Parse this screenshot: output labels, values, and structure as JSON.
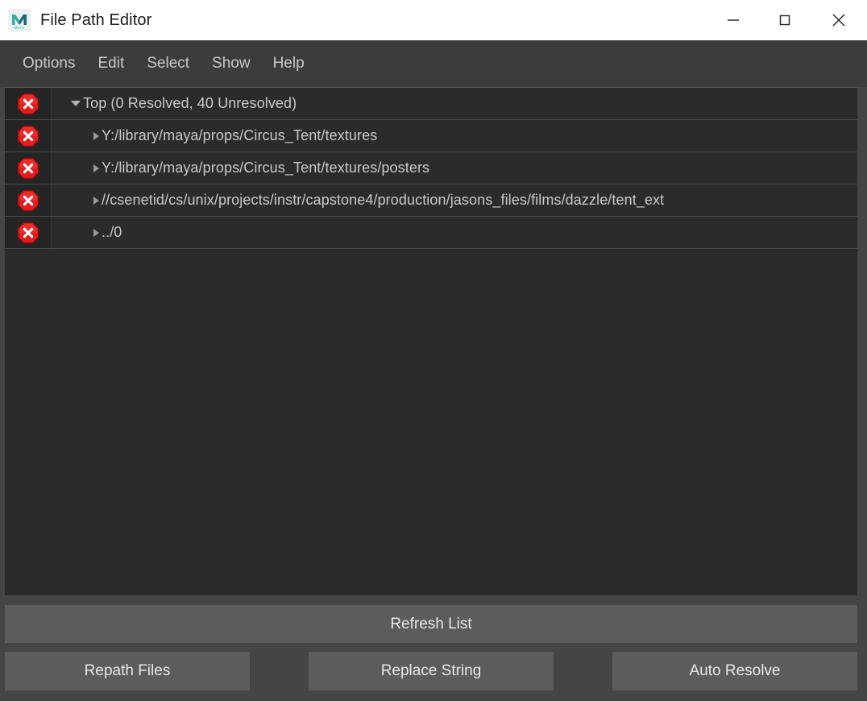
{
  "window": {
    "title": "File Path Editor",
    "app_icon": "maya-logo-icon",
    "controls": {
      "minimize": "minimize-icon",
      "maximize": "maximize-icon",
      "close": "close-icon"
    }
  },
  "menubar": {
    "items": [
      {
        "label": "Options"
      },
      {
        "label": "Edit"
      },
      {
        "label": "Select"
      },
      {
        "label": "Show"
      },
      {
        "label": "Help"
      }
    ]
  },
  "list": {
    "rows": [
      {
        "label": "Top (0 Resolved, 40 Unresolved)",
        "status": "unresolved",
        "status_icon": "error-x-icon",
        "expanded": true,
        "depth": 0
      },
      {
        "label": "Y:/library/maya/props/Circus_Tent/textures",
        "status": "unresolved",
        "status_icon": "error-x-icon",
        "expanded": false,
        "depth": 1
      },
      {
        "label": "Y:/library/maya/props/Circus_Tent/textures/posters",
        "status": "unresolved",
        "status_icon": "error-x-icon",
        "expanded": false,
        "depth": 1
      },
      {
        "label": "//csenetid/cs/unix/projects/instr/capstone4/production/jasons_files/films/dazzle/tent_ext",
        "status": "unresolved",
        "status_icon": "error-x-icon",
        "expanded": false,
        "depth": 1
      },
      {
        "label": "../0",
        "status": "unresolved",
        "status_icon": "error-x-icon",
        "expanded": false,
        "depth": 1
      }
    ]
  },
  "actions": {
    "refresh_label": "Refresh List",
    "repath_label": "Repath Files",
    "replace_label": "Replace String",
    "auto_resolve_label": "Auto Resolve"
  },
  "colors": {
    "titlebar_bg": "#ffffff",
    "titlebar_text": "#1b1b1b",
    "menubar_bg": "#3c3c3c",
    "panel_bg": "#454545",
    "list_bg": "#2b2b2b",
    "row_text": "#c9c9c9",
    "button_bg": "#5c5c5c",
    "error_red": "#e02020",
    "maya_teal": "#2a9d9a"
  }
}
